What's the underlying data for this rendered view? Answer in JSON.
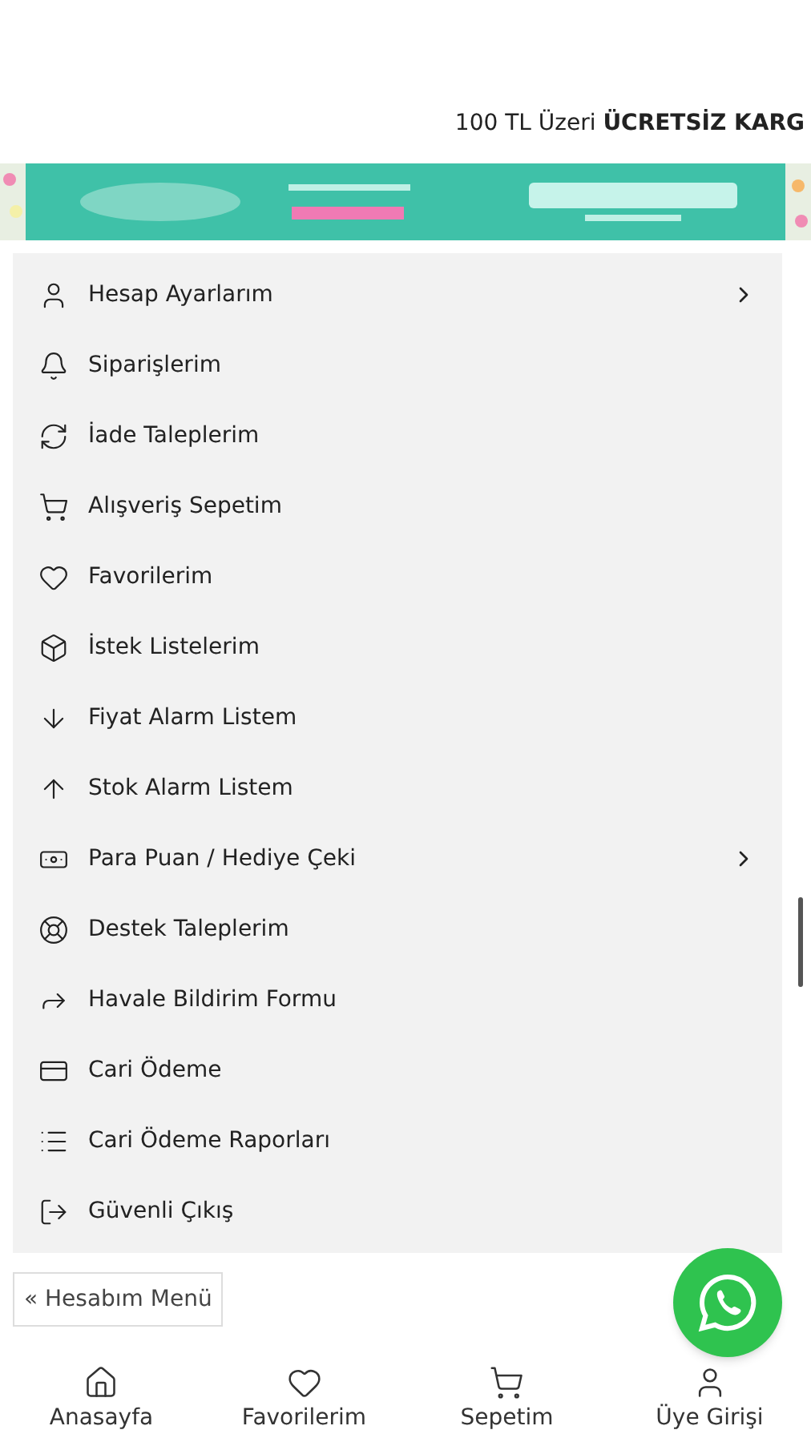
{
  "promo_bar": {
    "text": "100 TL Üzeri ",
    "bold": "ÜCRETSİZ KARG"
  },
  "account_menu": [
    {
      "label": "Hesap Ayarlarım",
      "has_submenu": true
    },
    {
      "label": "Siparişlerim",
      "has_submenu": false
    },
    {
      "label": "İade Taleplerim",
      "has_submenu": false
    },
    {
      "label": "Alışveriş Sepetim",
      "has_submenu": false
    },
    {
      "label": "Favorilerim",
      "has_submenu": false
    },
    {
      "label": "İstek Listelerim",
      "has_submenu": false
    },
    {
      "label": "Fiyat Alarm Listem",
      "has_submenu": false
    },
    {
      "label": "Stok Alarm Listem",
      "has_submenu": false
    },
    {
      "label": "Para Puan / Hediye Çeki",
      "has_submenu": true
    },
    {
      "label": "Destek Taleplerim",
      "has_submenu": false
    },
    {
      "label": "Havale Bildirim Formu",
      "has_submenu": false
    },
    {
      "label": "Cari Ödeme",
      "has_submenu": false
    },
    {
      "label": "Cari Ödeme Raporları",
      "has_submenu": false
    },
    {
      "label": "Güvenli Çıkış",
      "has_submenu": false
    }
  ],
  "menu_toggle": {
    "label": "« Hesabım Menü"
  },
  "bottom_nav": [
    {
      "label": "Anasayfa"
    },
    {
      "label": "Favorilerim"
    },
    {
      "label": "Sepetim"
    },
    {
      "label": "Üye Girişi"
    }
  ]
}
